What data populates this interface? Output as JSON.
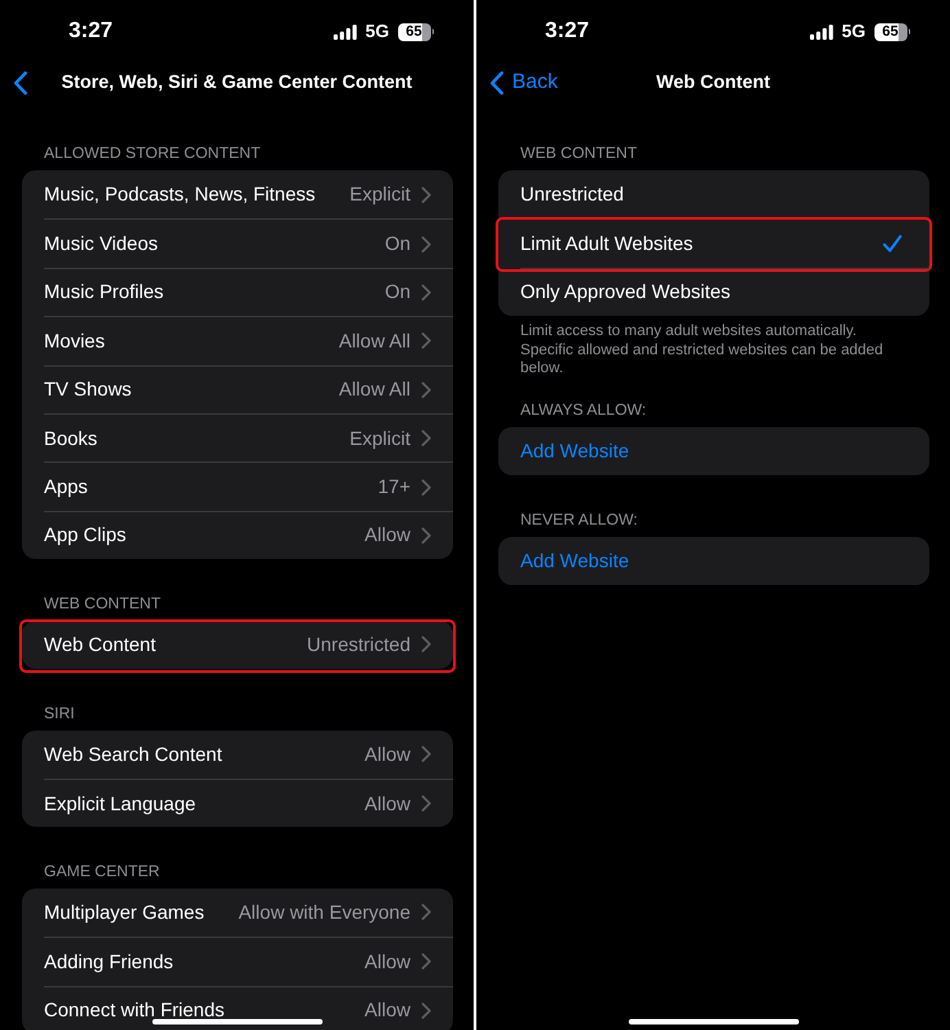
{
  "panels": [
    {
      "status_bar": {
        "time": "3:27",
        "network": "5G",
        "battery": "65"
      },
      "nav": {
        "title": "Store, Web, Siri & Game Center Content"
      },
      "sections": [
        {
          "header": "ALLOWED STORE CONTENT",
          "rows": [
            {
              "kind": "disclosure",
              "label": "Music, Podcasts, News, Fitness",
              "value": "Explicit",
              "highlighted": false
            },
            {
              "kind": "disclosure",
              "label": "Music Videos",
              "value": "On",
              "highlighted": false
            },
            {
              "kind": "disclosure",
              "label": "Music Profiles",
              "value": "On",
              "highlighted": false
            },
            {
              "kind": "disclosure",
              "label": "Movies",
              "value": "Allow All",
              "highlighted": false
            },
            {
              "kind": "disclosure",
              "label": "TV Shows",
              "value": "Allow All",
              "highlighted": false
            },
            {
              "kind": "disclosure",
              "label": "Books",
              "value": "Explicit",
              "highlighted": false
            },
            {
              "kind": "disclosure",
              "label": "Apps",
              "value": "17+",
              "highlighted": false
            },
            {
              "kind": "disclosure",
              "label": "App Clips",
              "value": "Allow",
              "highlighted": false
            }
          ]
        },
        {
          "header": "WEB CONTENT",
          "rows": [
            {
              "kind": "disclosure",
              "label": "Web Content",
              "value": "Unrestricted",
              "highlighted": true
            }
          ]
        },
        {
          "header": "SIRI",
          "rows": [
            {
              "kind": "disclosure",
              "label": "Web Search Content",
              "value": "Allow",
              "highlighted": false
            },
            {
              "kind": "disclosure",
              "label": "Explicit Language",
              "value": "Allow",
              "highlighted": false
            }
          ]
        },
        {
          "header": "GAME CENTER",
          "rows": [
            {
              "kind": "disclosure",
              "label": "Multiplayer Games",
              "value": "Allow with Everyone",
              "highlighted": false
            },
            {
              "kind": "disclosure",
              "label": "Adding Friends",
              "value": "Allow",
              "highlighted": false
            },
            {
              "kind": "disclosure",
              "label": "Connect with Friends",
              "value": "Allow",
              "highlighted": false
            }
          ]
        }
      ]
    },
    {
      "status_bar": {
        "time": "3:27",
        "network": "5G",
        "battery": "65"
      },
      "nav": {
        "back_label": "Back",
        "title": "Web Content"
      },
      "sections": [
        {
          "header": "WEB CONTENT",
          "rows": [
            {
              "kind": "option",
              "label": "Unrestricted",
              "selected": false,
              "highlighted": false
            },
            {
              "kind": "option",
              "label": "Limit Adult Websites",
              "selected": true,
              "highlighted": true
            },
            {
              "kind": "option",
              "label": "Only Approved Websites",
              "selected": false,
              "highlighted": false
            }
          ],
          "footer": "Limit access to many adult websites automatically. Specific allowed and restricted websites can be added below."
        },
        {
          "header": "ALWAYS ALLOW:",
          "rows": [
            {
              "kind": "action",
              "label": "Add Website",
              "highlighted": false
            }
          ]
        },
        {
          "header": "NEVER ALLOW:",
          "rows": [
            {
              "kind": "action",
              "label": "Add Website",
              "highlighted": false
            }
          ]
        }
      ]
    }
  ]
}
